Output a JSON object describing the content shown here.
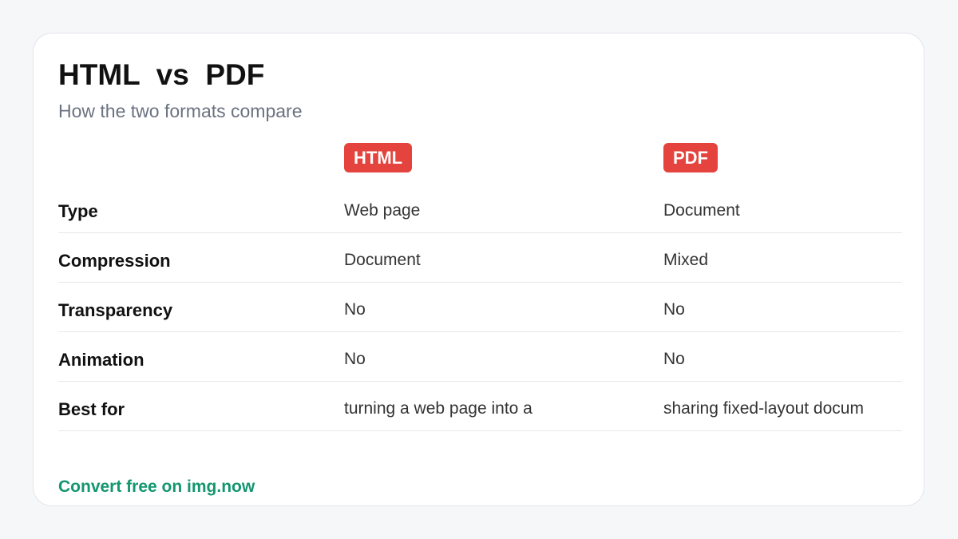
{
  "header": {
    "title": "HTML  vs  PDF",
    "subtitle": "How the two formats compare"
  },
  "columns": [
    {
      "badge": "HTML",
      "color": "#e5433d"
    },
    {
      "badge": "PDF",
      "color": "#e5433d"
    }
  ],
  "rows": [
    {
      "label": "Type",
      "html": "Web page",
      "pdf": "Document"
    },
    {
      "label": "Compression",
      "html": "Document",
      "pdf": "Mixed"
    },
    {
      "label": "Transparency",
      "html": "No",
      "pdf": "No"
    },
    {
      "label": "Animation",
      "html": "No",
      "pdf": "No"
    },
    {
      "label": "Best for",
      "html": "turning a web page into a",
      "pdf": "sharing fixed-layout docum"
    }
  ],
  "footer": {
    "link_text": "Convert free on img.now",
    "link_color": "#14966f"
  },
  "colors": {
    "background": "#f6f7f9",
    "card": "#ffffff",
    "badge": "#e5433d",
    "accent": "#14966f"
  }
}
